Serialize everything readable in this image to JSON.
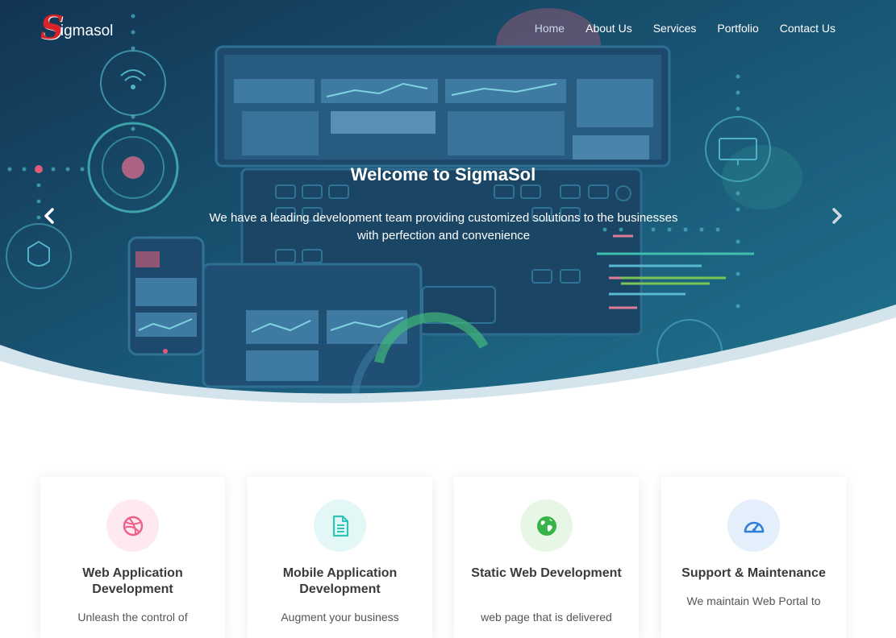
{
  "brand": {
    "logo_letter": "S",
    "logo_rest": "igmasol"
  },
  "nav": {
    "items": [
      "Home",
      "About Us",
      "Services",
      "Portfolio",
      "Contact Us"
    ],
    "active": "Home"
  },
  "hero": {
    "title": "Welcome to SigmaSol",
    "subtitle": "We have a leading development team providing customized solutions to the businesses with perfection and convenience"
  },
  "services": [
    {
      "title": "Web Application Development",
      "desc": "Unleash the control of",
      "icon": "dribbble-icon",
      "icon_color": "#ef5f8a",
      "bg": "#fde9ef"
    },
    {
      "title": "Mobile Application Development",
      "desc": "Augment your business",
      "icon": "document-icon",
      "icon_color": "#2ec4b6",
      "bg": "#e3f8f6"
    },
    {
      "title": "Static Web Development",
      "desc": "web page that is delivered",
      "icon": "globe-icon",
      "icon_color": "#37b34a",
      "bg": "#e6f7e5"
    },
    {
      "title": "Support & Maintenance",
      "desc": "We maintain Web Portal to",
      "icon": "speedometer-icon",
      "icon_color": "#2f7fd8",
      "bg": "#e4effc"
    }
  ],
  "colors": {
    "hero_dark": "#0f2e4a",
    "hero_teal": "#1d6f84",
    "wave": "#d4e4ec"
  }
}
